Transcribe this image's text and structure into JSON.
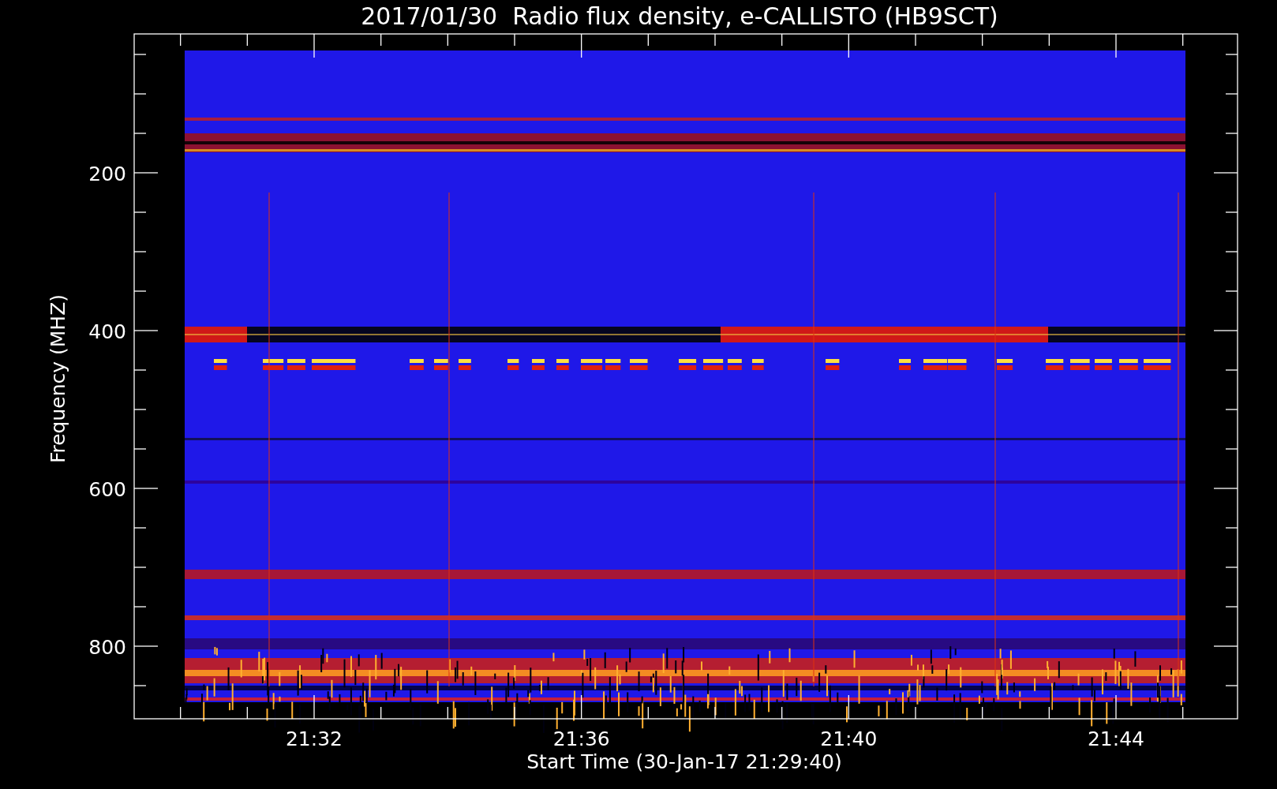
{
  "title": "2017/01/30  Radio flux density, e-CALLISTO (HB9SCT)",
  "y_axis": {
    "label": "Frequency (MHZ)",
    "tick_labels": [
      "200",
      "400",
      "600",
      "800"
    ]
  },
  "x_axis": {
    "label": "Start Time (30-Jan-17 21:29:40)",
    "tick_labels": [
      "21:32",
      "21:36",
      "21:40",
      "21:44"
    ]
  }
}
